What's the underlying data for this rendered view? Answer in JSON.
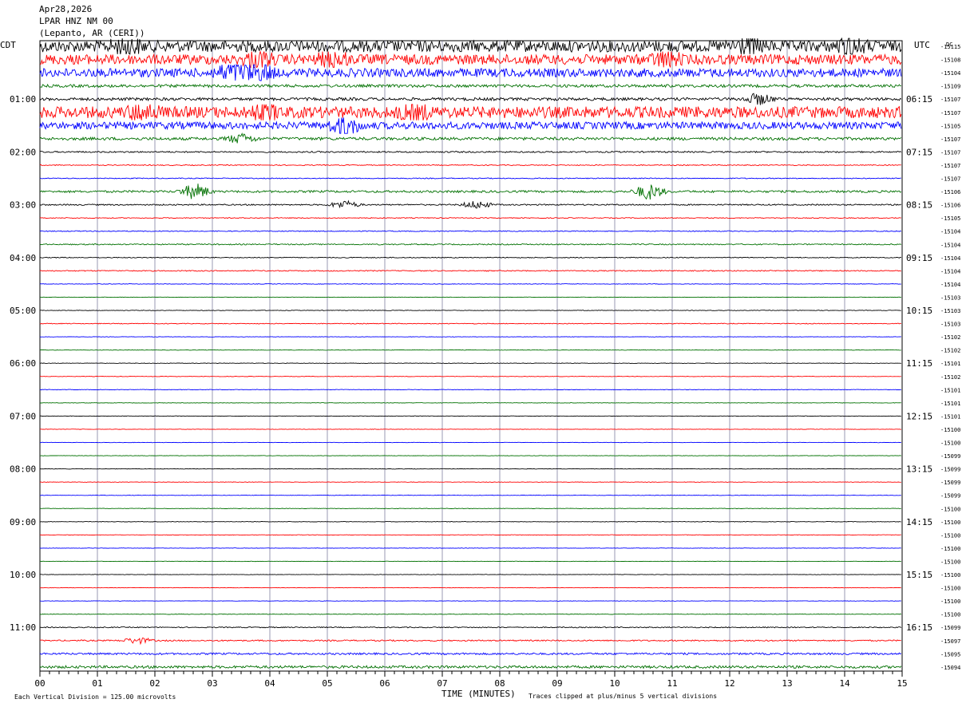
{
  "header": {
    "date": "Apr28,2026",
    "station": "LPAR HNZ NM 00",
    "location": "(Lepanto, AR (CERI))"
  },
  "left_axis_title": "CDT",
  "right_axis_title": "UTC",
  "dc_title": "DC",
  "footer": {
    "x_title": "TIME (MINUTES)",
    "scale_note": "Each Vertical Division =  125.00 microvolts",
    "clip_note": "Traces clipped at plus/minus 5 vertical divisions"
  },
  "chart_data": {
    "type": "line",
    "title": "LPAR HNZ NM 00",
    "xlabel": "TIME (MINUTES)",
    "xlim": [
      0,
      15
    ],
    "x_ticks": [
      "00",
      "01",
      "02",
      "03",
      "04",
      "05",
      "06",
      "07",
      "08",
      "09",
      "10",
      "11",
      "12",
      "13",
      "14",
      "15"
    ],
    "line_minutes": 15,
    "trace_colors": [
      "#000000",
      "#ff0000",
      "#0000ff",
      "#007000"
    ],
    "left_hour_labels": [
      "01:00",
      "02:00",
      "03:00",
      "04:00",
      "05:00",
      "06:00",
      "07:00",
      "08:00",
      "09:00",
      "10:00",
      "11:00"
    ],
    "right_hour_labels": [
      "06:15",
      "07:15",
      "08:15",
      "09:15",
      "10:15",
      "11:15",
      "12:15",
      "13:15",
      "14:15",
      "15:15",
      "16:15"
    ],
    "dc_offsets": [
      -15115,
      -15108,
      -15104,
      -15109,
      -15107,
      -15107,
      -15105,
      -15107,
      -15107,
      -15107,
      -15107,
      -15106,
      -15106,
      -15105,
      -15104,
      -15104,
      -15104,
      -15104,
      -15104,
      -15103,
      -15103,
      -15103,
      -15102,
      -15102,
      -15101,
      -15102,
      -15101,
      -15101,
      -15101,
      -15100,
      -15100,
      -15099,
      -15099,
      -15099,
      -15099,
      -15100,
      -15100,
      -15100,
      -15100,
      -15100,
      -15100,
      -15100,
      -15100,
      -15100,
      -15099,
      -15097,
      -15095,
      -15094
    ],
    "trace_activity": [
      8,
      7,
      6,
      2,
      2,
      8,
      5,
      2,
      1,
      0.6,
      0.6,
      1.5,
      0.9,
      0.6,
      0.6,
      0.8,
      0.6,
      0.7,
      0.4,
      0.3,
      0.4,
      0.5,
      0.3,
      0.3,
      0.3,
      0.3,
      0.3,
      0.3,
      0.3,
      0.3,
      0.3,
      0.3,
      0.3,
      0.3,
      0.3,
      0.3,
      0.3,
      0.3,
      0.3,
      0.3,
      0.3,
      0.3,
      0.3,
      0.4,
      0.7,
      0.9,
      1.3,
      1.8
    ],
    "events": [
      {
        "line": 0,
        "minute": 1.5,
        "amp": 10
      },
      {
        "line": 0,
        "minute": 12.3,
        "amp": 10
      },
      {
        "line": 0,
        "minute": 14.1,
        "amp": 10
      },
      {
        "line": 1,
        "minute": 3.8,
        "amp": 9
      },
      {
        "line": 1,
        "minute": 5.1,
        "amp": 9
      },
      {
        "line": 1,
        "minute": 10.9,
        "amp": 8
      },
      {
        "line": 2,
        "minute": 3.3,
        "amp": 12
      },
      {
        "line": 2,
        "minute": 3.8,
        "amp": 12
      },
      {
        "line": 4,
        "minute": 12.5,
        "amp": 7
      },
      {
        "line": 5,
        "minute": 1.8,
        "amp": 9
      },
      {
        "line": 5,
        "minute": 3.9,
        "amp": 9
      },
      {
        "line": 5,
        "minute": 6.5,
        "amp": 9
      },
      {
        "line": 6,
        "minute": 5.3,
        "amp": 12
      },
      {
        "line": 7,
        "minute": 3.5,
        "amp": 6
      },
      {
        "line": 11,
        "minute": 2.7,
        "amp": 10
      },
      {
        "line": 11,
        "minute": 10.6,
        "amp": 10
      },
      {
        "line": 12,
        "minute": 5.3,
        "amp": 5
      },
      {
        "line": 12,
        "minute": 7.6,
        "amp": 5
      },
      {
        "line": 45,
        "minute": 1.7,
        "amp": 4
      }
    ]
  }
}
